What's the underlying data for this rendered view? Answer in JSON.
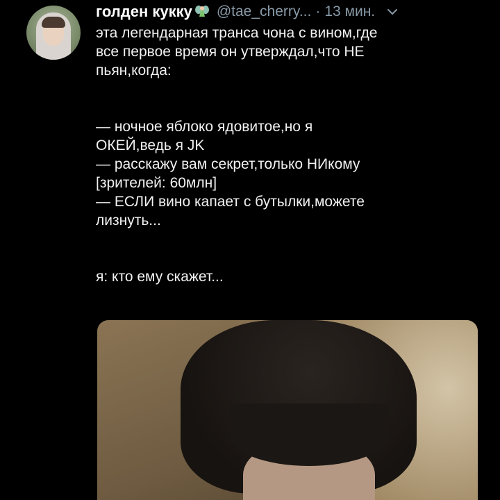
{
  "tweet": {
    "display_name": "голден кукку",
    "name_emoji_icon": "fairy-icon",
    "handle": "@tae_cherry...",
    "separator": "·",
    "timestamp": "13 мин.",
    "menu_icon": "chevron-down-icon",
    "lines": [
      "эта легендарная транса чона с вином,где",
      "все первое время он утверждал,что НЕ",
      "пьян,когда:",
      "",
      "— ночное яблоко ядовитое,но я",
      "ОКЕЙ,ведь я JK",
      "— расскажу вам секрет,только НИкому",
      "[зрителей: 60млн]",
      "— ЕСЛИ вино капает с бутылки,можете",
      "лизнуть...",
      "",
      "я: кто ему скажет..."
    ]
  },
  "colors": {
    "background": "#000000",
    "text": "#f1f1f1",
    "muted": "#8899a6"
  }
}
